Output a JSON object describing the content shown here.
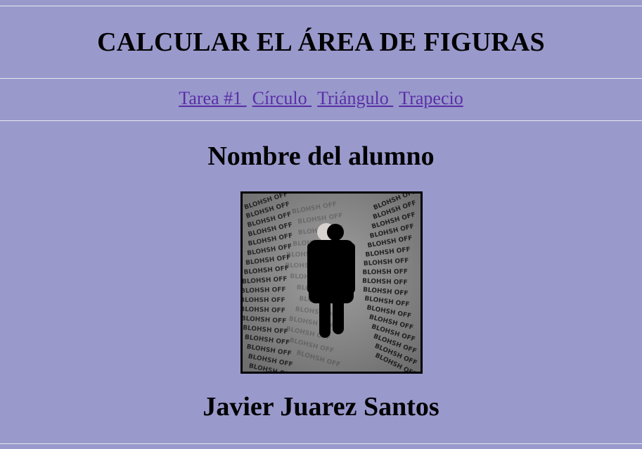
{
  "header": {
    "title": "CALCULAR EL ÁREA DE FIGURAS"
  },
  "nav": {
    "links": [
      {
        "label": "Tarea #1 "
      },
      {
        "label": "Círculo "
      },
      {
        "label": "Triángulo "
      },
      {
        "label": "Trapecio"
      }
    ]
  },
  "main": {
    "subtitle": "Nombre del alumno",
    "student_name": "Javier Juarez Santos"
  },
  "photo": {
    "artwork_text": "BLOHSH OFF"
  },
  "colors": {
    "background": "#9999cc",
    "link": "#5a2ea6",
    "rule": "#e8e8f0"
  }
}
